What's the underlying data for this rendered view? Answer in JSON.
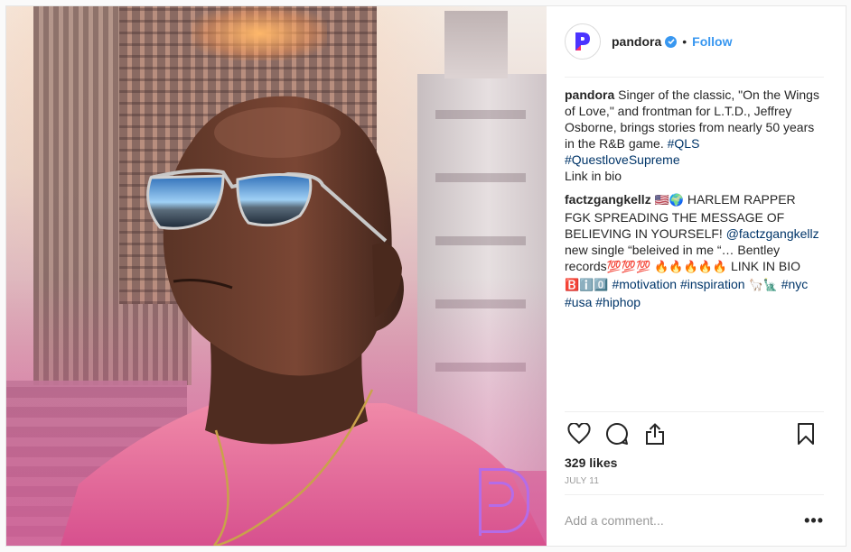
{
  "post": {
    "account": {
      "username": "pandora",
      "verified": true,
      "separator": "•",
      "follow_label": "Follow",
      "avatar_icon": "pandora-logo-icon",
      "brand_color": "#4b34ff"
    },
    "caption": {
      "username": "pandora",
      "text": "Singer of the classic, \"On the Wings of Love,\" and frontman for L.T.D., Jeffrey Osborne, brings stories from nearly 50 years in the R&B game.",
      "hashtags": [
        "#QLS",
        "#QuestloveSupreme"
      ],
      "trailing": "Link in bio"
    },
    "comments": [
      {
        "username": "factzgangkellz",
        "emoji_1": "🇺🇸🌍",
        "text_1": "HARLEM RAPPER FGK SPREADING THE MESSAGE OF BELIEVING IN YOURSELF!",
        "mention": "@factzgangkellz",
        "text_2": "new single “beleived in me “… Bentley records",
        "emoji_2": "💯💯💯",
        "emoji_3": "🔥🔥🔥🔥🔥",
        "text_3": "LINK IN BIO",
        "emoji_4": "🅱️ℹ️0️⃣",
        "hashtags_1": [
          "#motivation",
          "#inspiration"
        ],
        "emoji_5": "🦙🗽",
        "hashtags_2": [
          "#nyc",
          "#usa",
          "#hiphop"
        ]
      }
    ],
    "actions": {
      "like_icon": "heart-icon",
      "comment_icon": "comment-icon",
      "share_icon": "share-icon",
      "save_icon": "bookmark-icon"
    },
    "likes": "329 likes",
    "date": "JULY 11",
    "add_comment": {
      "placeholder": "Add a comment...",
      "more_label": "•••"
    },
    "colors": {
      "link": "#3897f0",
      "hashtag": "#003569",
      "muted": "#999999",
      "photo_overlay_logo": "#b46ce8"
    }
  }
}
